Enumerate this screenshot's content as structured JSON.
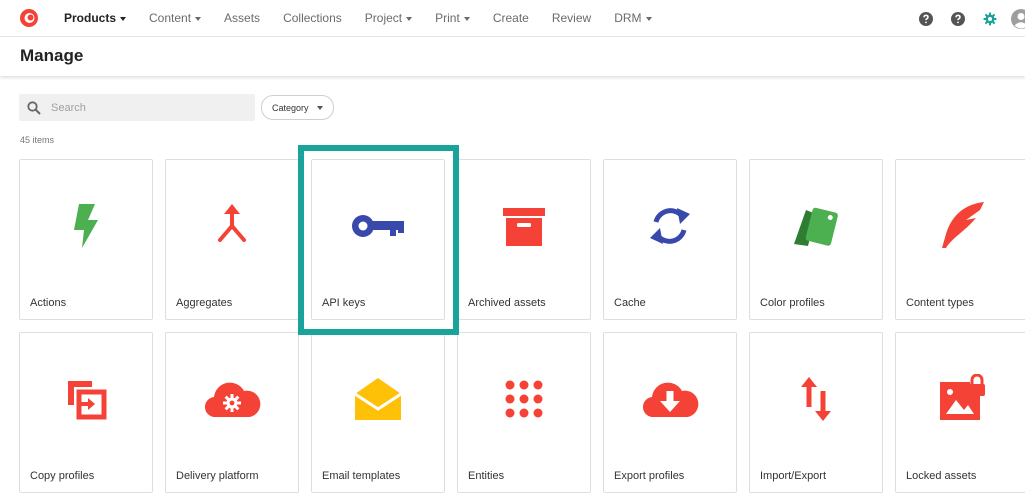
{
  "nav": {
    "items": [
      {
        "label": "Products",
        "active": true,
        "dropdown": true
      },
      {
        "label": "Content",
        "active": false,
        "dropdown": true
      },
      {
        "label": "Assets",
        "active": false,
        "dropdown": false
      },
      {
        "label": "Collections",
        "active": false,
        "dropdown": false
      },
      {
        "label": "Project",
        "active": false,
        "dropdown": true
      },
      {
        "label": "Print",
        "active": false,
        "dropdown": true
      },
      {
        "label": "Create",
        "active": false,
        "dropdown": false
      },
      {
        "label": "Review",
        "active": false,
        "dropdown": false
      },
      {
        "label": "DRM",
        "active": false,
        "dropdown": true
      }
    ],
    "right_icons": [
      "help-icon",
      "help-icon",
      "gear-icon",
      "user-avatar-icon"
    ]
  },
  "header": {
    "title": "Manage"
  },
  "toolbar": {
    "search_placeholder": "Search",
    "search_value": "",
    "category_label": "Category"
  },
  "items_count": "45 items",
  "tiles": [
    {
      "label": "Actions",
      "icon": "lightning-icon",
      "color": "#4caf50"
    },
    {
      "label": "Aggregates",
      "icon": "merge-arrow-icon",
      "color": "#f44336"
    },
    {
      "label": "API keys",
      "icon": "key-icon",
      "color": "#3949ab"
    },
    {
      "label": "Archived assets",
      "icon": "archive-box-icon",
      "color": "#f44336"
    },
    {
      "label": "Cache",
      "icon": "refresh-icon",
      "color": "#3949ab"
    },
    {
      "label": "Color profiles",
      "icon": "color-swatch-icon",
      "color": "#4caf50"
    },
    {
      "label": "Content types",
      "icon": "feather-icon",
      "color": "#f44336"
    },
    {
      "label": "Copy profiles",
      "icon": "copy-arrow-icon",
      "color": "#f44336"
    },
    {
      "label": "Delivery platform",
      "icon": "cloud-gear-icon",
      "color": "#f44336"
    },
    {
      "label": "Email templates",
      "icon": "envelope-icon",
      "color": "#ffc107"
    },
    {
      "label": "Entities",
      "icon": "dot-grid-icon",
      "color": "#f44336"
    },
    {
      "label": "Export profiles",
      "icon": "cloud-download-icon",
      "color": "#f44336"
    },
    {
      "label": "Import/Export",
      "icon": "up-down-arrows-icon",
      "color": "#f44336"
    },
    {
      "label": "Locked assets",
      "icon": "locked-image-icon",
      "color": "#f44336"
    }
  ],
  "highlighted_tile": "API keys",
  "colors": {
    "accent": "#1aa39a",
    "logo": "#f44336"
  }
}
